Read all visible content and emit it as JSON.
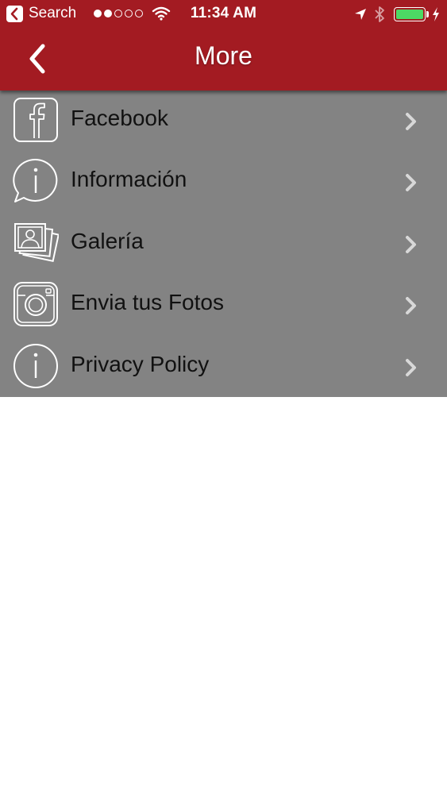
{
  "status_bar": {
    "back_app": "Search",
    "time": "11:34 AM",
    "signal_dots_filled": 2,
    "signal_dots_total": 5
  },
  "nav": {
    "title": "More"
  },
  "menu": [
    {
      "label": "Facebook",
      "icon": "facebook-icon"
    },
    {
      "label": "Información",
      "icon": "info-bubble-icon"
    },
    {
      "label": "Galería",
      "icon": "photo-gallery-icon"
    },
    {
      "label": "Envia tus Fotos",
      "icon": "camera-icon"
    },
    {
      "label": "Privacy Policy",
      "icon": "info-circle-icon"
    }
  ],
  "colors": {
    "header": "#a31b22",
    "list_background": "#838383",
    "battery": "#4cd964",
    "chevron": "#d8d8d8"
  }
}
